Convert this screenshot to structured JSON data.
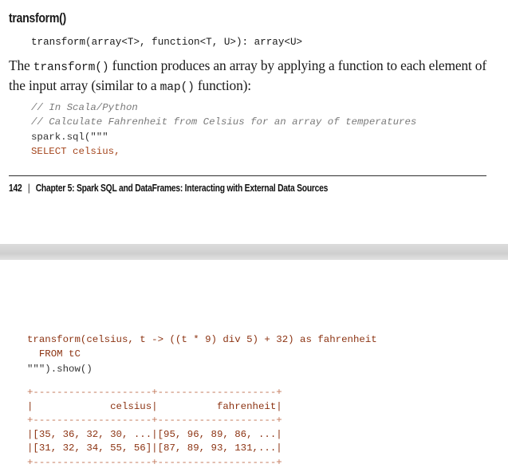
{
  "heading": "transform()",
  "signature": "transform(array<T>, function<T, U>): array<U>",
  "paragraph": {
    "p1": "The ",
    "code1": "transform()",
    "p2": " function produces an array by applying a function to each element of the input array (similar to a ",
    "code2": "map()",
    "p3": " function):"
  },
  "code_top": {
    "line1": "// In Scala/Python",
    "line2": "// Calculate Fahrenheit from Celsius for an array of temperatures",
    "line3": "spark.sql(\"\"\"",
    "line4": "SELECT celsius,"
  },
  "footer": {
    "page_number": "142",
    "separator": "|",
    "chapter": "Chapter 5: Spark SQL and DataFrames: Interacting with External Data Sources"
  },
  "code_bottom": {
    "line1": "transform(celsius, t -> ((t * 9) div 5) + 32) as fahrenheit",
    "line2": "  FROM tC",
    "line3": "\"\"\").show()"
  },
  "table": {
    "border": "+--------------------+--------------------+",
    "header": "|             celsius|          fahrenheit|",
    "row1": "|[35, 36, 32, 30, ...|[95, 96, 89, 86, ...|",
    "row2": "|[31, 32, 34, 55, 56]|[87, 89, 93, 131,...|"
  }
}
